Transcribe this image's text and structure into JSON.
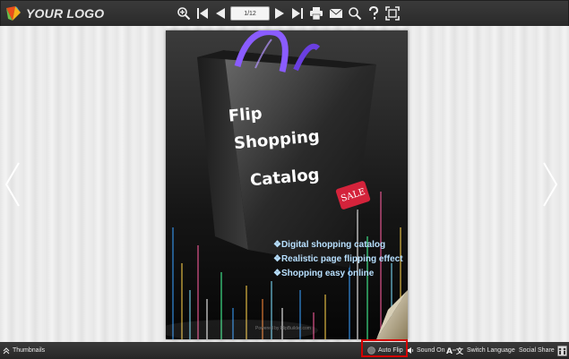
{
  "toolbar": {
    "logo_text": "YOUR LOGO",
    "page_indicator": "1/12",
    "icons": [
      "zoom-in-icon",
      "first-page-icon",
      "previous-page-icon",
      "next-page-icon",
      "last-page-icon",
      "print-icon",
      "email-icon",
      "search-icon",
      "help-icon",
      "fullscreen-icon"
    ]
  },
  "page": {
    "words": [
      "Flip",
      "Shopping",
      "Catalog"
    ],
    "sale": "SALE",
    "bullets": [
      "❖Digital shopping catalog",
      "❖Realistic page flipping effect",
      "❖Shopping easy online"
    ],
    "footer": "Powered by FlipBuilder.com"
  },
  "bottom": {
    "thumbnails": "Thumbnails",
    "auto_flip": "Auto Flip",
    "sound": "Sound On",
    "switch_language": "Switch Language",
    "social_share": "Social Share"
  },
  "colors": {
    "highlight": "#d40000",
    "bullet_text": "#b8e0ff",
    "bag_handle": "#8a5cff"
  }
}
